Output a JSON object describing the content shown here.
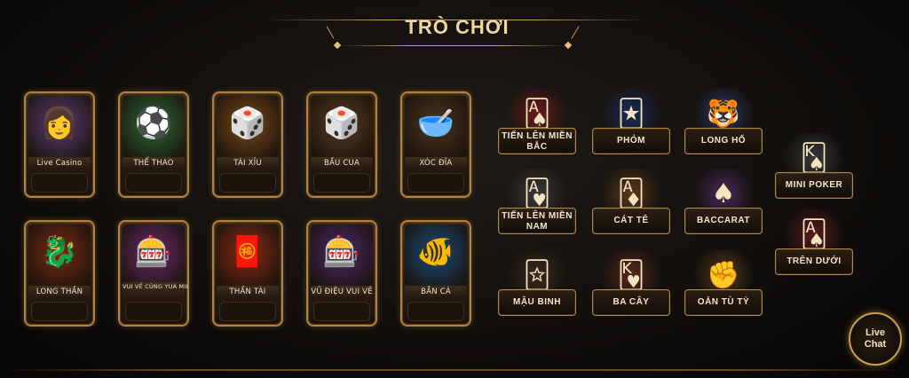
{
  "header": {
    "title": "TRÒ CHƠI"
  },
  "cards": [
    {
      "name": "card-live-casino",
      "label": "Live Casino",
      "icon": "dealer-icon",
      "glyph": "👩",
      "accent": "#5b3f7a"
    },
    {
      "name": "card-the-thao",
      "label": "THỂ THAO",
      "icon": "soccer-icon",
      "glyph": "⚽",
      "accent": "#2f6b3a"
    },
    {
      "name": "card-tai-xiu",
      "label": "TÀI XỈU",
      "icon": "dice-icon",
      "glyph": "🎲",
      "accent": "#7a4a1a"
    },
    {
      "name": "card-bau-cua",
      "label": "BẦU CUA",
      "icon": "dice-cube-icon",
      "glyph": "🎲",
      "accent": "#5a3a22"
    },
    {
      "name": "card-xoc-dia",
      "label": "XÓC ĐĨA",
      "icon": "bowl-icon",
      "glyph": "🥣",
      "accent": "#4a3520"
    },
    {
      "name": "card-long-than",
      "label": "LONG THẦN",
      "icon": "dragon-icon",
      "glyph": "🐉",
      "accent": "#7a2a14"
    },
    {
      "name": "card-vui-ve-cung-yua-mikami",
      "label": "VUI VẺ CÙNG YUA MIKAMI",
      "icon": "slot-machine-icon",
      "glyph": "🎰",
      "accent": "#6a2a6a"
    },
    {
      "name": "card-than-tai",
      "label": "THẦN TÀI",
      "icon": "god-of-wealth-icon",
      "glyph": "🧧",
      "accent": "#8a2a14"
    },
    {
      "name": "card-vu-dieu-vui-ve",
      "label": "VŨ ĐIỆU VUI VẺ",
      "icon": "disco-slot-icon",
      "glyph": "🎰",
      "accent": "#4a2a6a"
    },
    {
      "name": "card-ban-ca",
      "label": "BẮN CÁ",
      "icon": "fish-icon",
      "glyph": "🐠",
      "accent": "#1a4a7a"
    }
  ],
  "tiles": [
    {
      "name": "tile-tien-len-mien-bac",
      "label": "TIẾN LÊN MIỀN BẮC",
      "icon": "playing-cards-icon",
      "glyph": "🂡",
      "accent": "#6a1a1a"
    },
    {
      "name": "tile-phom",
      "label": "PHỎM",
      "icon": "card-table-icon",
      "glyph": "🃏",
      "accent": "#1a2a5a"
    },
    {
      "name": "tile-long-ho",
      "label": "LONG HỔ",
      "icon": "dragon-tiger-icon",
      "glyph": "🐯",
      "accent": "#2a3a6a"
    },
    {
      "name": "tile-mini-poker",
      "label": "MINI POKER",
      "icon": "poker-cards-icon",
      "glyph": "🂮",
      "accent": "#3a3a3a"
    },
    {
      "name": "tile-tien-len-mien-nam",
      "label": "TIẾN LÊN MIỀN NAM",
      "icon": "playing-cards-icon",
      "glyph": "🂱",
      "accent": "#3a3a3a"
    },
    {
      "name": "tile-cat-te",
      "label": "CÁT TÊ",
      "icon": "cards-coins-icon",
      "glyph": "🃁",
      "accent": "#5a3a1a"
    },
    {
      "name": "tile-baccarat",
      "label": "BACCARAT",
      "icon": "baccarat-icon",
      "glyph": "♠",
      "accent": "#4a2a5a"
    },
    {
      "name": "tile-tren-duoi",
      "label": "TRÊN DƯỚI",
      "icon": "aces-icon",
      "glyph": "🂡",
      "accent": "#5a1a1a"
    },
    {
      "name": "tile-mau-binh",
      "label": "MẬU BINH",
      "icon": "joker-cards-icon",
      "glyph": "🃟",
      "accent": "#3a2a1a"
    },
    {
      "name": "tile-ba-cay",
      "label": "BA CÂY",
      "icon": "three-cards-icon",
      "glyph": "🂾",
      "accent": "#5a2a1a"
    },
    {
      "name": "tile-oan-tu-ty",
      "label": "OẢN TÙ TỲ",
      "icon": "rock-paper-scissors-icon",
      "glyph": "✊",
      "accent": "#5a3a1a"
    }
  ],
  "livechat": {
    "line1": "Live",
    "line2": "Chat"
  }
}
